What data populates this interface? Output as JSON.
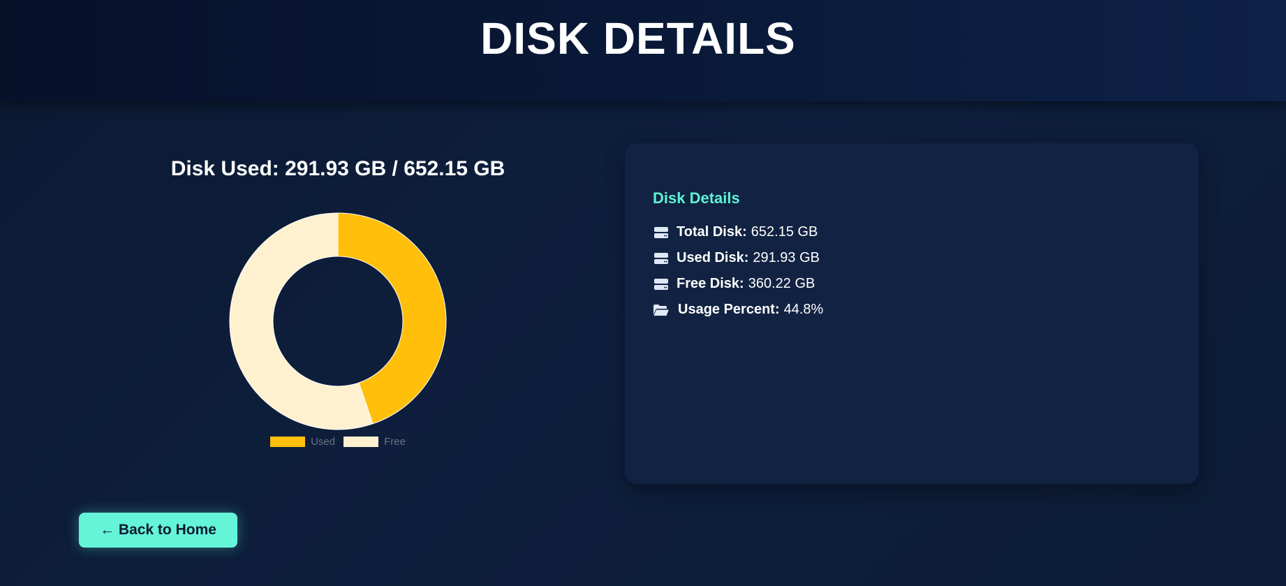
{
  "header": {
    "title": "DISK DETAILS"
  },
  "chart_panel": {
    "title": "Disk Used: 291.93 GB / 652.15 GB"
  },
  "chart_data": {
    "type": "pie",
    "variant": "doughnut",
    "categories": [
      "Used",
      "Free"
    ],
    "values": [
      291.93,
      360.22
    ],
    "unit": "GB",
    "colors": [
      "#ffbf0a",
      "#fff1d0"
    ],
    "legend": "bottom"
  },
  "details_card": {
    "title": "Disk Details",
    "rows": [
      {
        "icon": "hard-drive-icon",
        "label": "Total Disk:",
        "value": "652.15 GB"
      },
      {
        "icon": "hard-drive-icon",
        "label": "Used Disk:",
        "value": "291.93 GB"
      },
      {
        "icon": "hard-drive-icon",
        "label": "Free Disk:",
        "value": "360.22 GB"
      },
      {
        "icon": "folder-open-icon",
        "label": "Usage Percent:",
        "value": "44.8%"
      }
    ]
  },
  "back_button": {
    "label": "← Back to Home"
  },
  "colors": {
    "accent": "#64f4d8",
    "card_title": "#5ef2d5",
    "used": "#ffbf0a",
    "free": "#fff1d0"
  }
}
